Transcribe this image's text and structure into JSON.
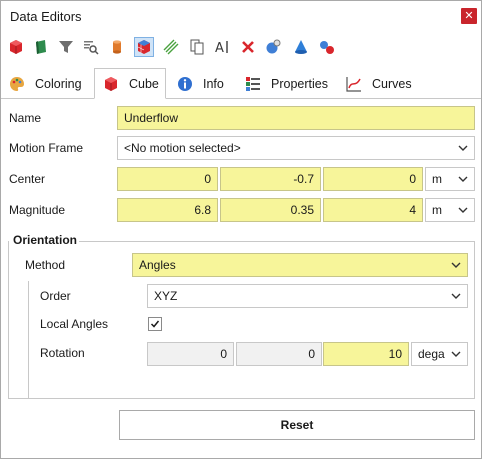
{
  "window": {
    "title": "Data Editors",
    "close_glyph": "✕"
  },
  "toolbar": {
    "icons": [
      "red-cube-icon",
      "green-flag-icon",
      "funnel-icon",
      "search-list-icon",
      "cylinder-icon",
      "cube-grid-icon",
      "hatch-icon",
      "copy-icon",
      "text-cursor-icon",
      "delete-icon",
      "camera-sphere-icon",
      "cone-icon",
      "molecule-icon"
    ],
    "active_icon": "cube-grid-icon"
  },
  "tabs": [
    {
      "label": "Coloring",
      "icon": "palette-icon",
      "active": false
    },
    {
      "label": "Cube",
      "icon": "cube-icon",
      "active": true
    },
    {
      "label": "Info",
      "icon": "info-icon",
      "active": false
    },
    {
      "label": "Properties",
      "icon": "properties-icon",
      "active": false
    },
    {
      "label": "Curves",
      "icon": "curve-icon",
      "active": false
    }
  ],
  "form": {
    "name": {
      "label": "Name",
      "value": "Underflow"
    },
    "motion_frame": {
      "label": "Motion Frame",
      "value": "<No motion selected>"
    },
    "center": {
      "label": "Center",
      "x": "0",
      "y": "-0.7",
      "z": "0",
      "unit": "m"
    },
    "magnitude": {
      "label": "Magnitude",
      "x": "6.8",
      "y": "0.35",
      "z": "4",
      "unit": "m"
    },
    "orientation": {
      "title": "Orientation",
      "method": {
        "label": "Method",
        "value": "Angles"
      },
      "order": {
        "label": "Order",
        "value": "XYZ"
      },
      "local_angles": {
        "label": "Local Angles",
        "checked": true
      },
      "rotation": {
        "label": "Rotation",
        "x": "0",
        "y": "0",
        "z": "10",
        "unit": "dega"
      }
    }
  },
  "reset_label": "Reset",
  "colors": {
    "highlight": "#f7f59a",
    "tab_border": "#c8c8c8",
    "close": "#c9252c"
  }
}
